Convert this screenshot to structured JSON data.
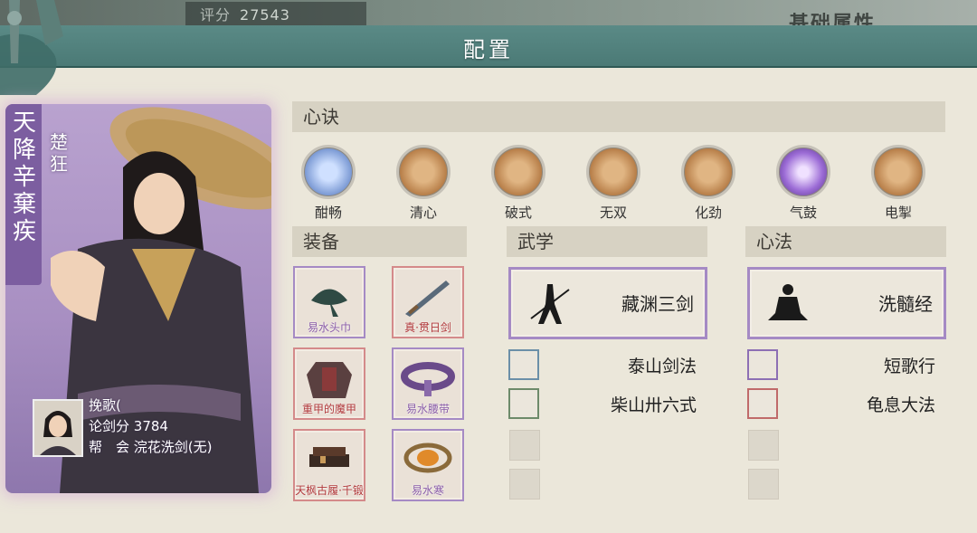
{
  "top": {
    "score_label": "评分",
    "score_value": "27543",
    "base_attr": "基础属性"
  },
  "header": {
    "title": "配置"
  },
  "character": {
    "name": "天降辛棄疾",
    "nickname": "楚狂",
    "player_name": "挽歌( ",
    "sword_score_label": "论剑分",
    "sword_score": "3784",
    "guild_label": "帮　会",
    "guild": "浣花洗剑(无)"
  },
  "sections": {
    "xinjue": "心诀",
    "equipment": "装备",
    "wuxue": "武学",
    "xinfa": "心法"
  },
  "xinjue": [
    {
      "label": "酣畅",
      "style": "blue"
    },
    {
      "label": "清心",
      "style": "gold"
    },
    {
      "label": "破式",
      "style": "gold"
    },
    {
      "label": "无双",
      "style": "gold"
    },
    {
      "label": "化劲",
      "style": "gold"
    },
    {
      "label": "气鼓",
      "style": "purple"
    },
    {
      "label": "电掣",
      "style": "gold"
    }
  ],
  "equipment": [
    {
      "label": "易水头巾",
      "rarity": "purple"
    },
    {
      "label": "真·贯日剑",
      "rarity": "red"
    },
    {
      "label": "重甲的魔甲",
      "rarity": "red"
    },
    {
      "label": "易水腰带",
      "rarity": "purple"
    },
    {
      "label": "天枫古履·千锻",
      "rarity": "red"
    },
    {
      "label": "易水寒",
      "rarity": "purple"
    }
  ],
  "wuxue": {
    "main": "藏渊三剑",
    "others": [
      "泰山剑法",
      "柴山卅六式"
    ]
  },
  "xinfa": {
    "main": "洗髓经",
    "others": [
      "短歌行",
      "龟息大法"
    ]
  },
  "colors": {
    "header": "#4b7a76",
    "card": "#a88fc2",
    "purple_border": "#a58ac4",
    "red_border": "#d48a8a"
  }
}
